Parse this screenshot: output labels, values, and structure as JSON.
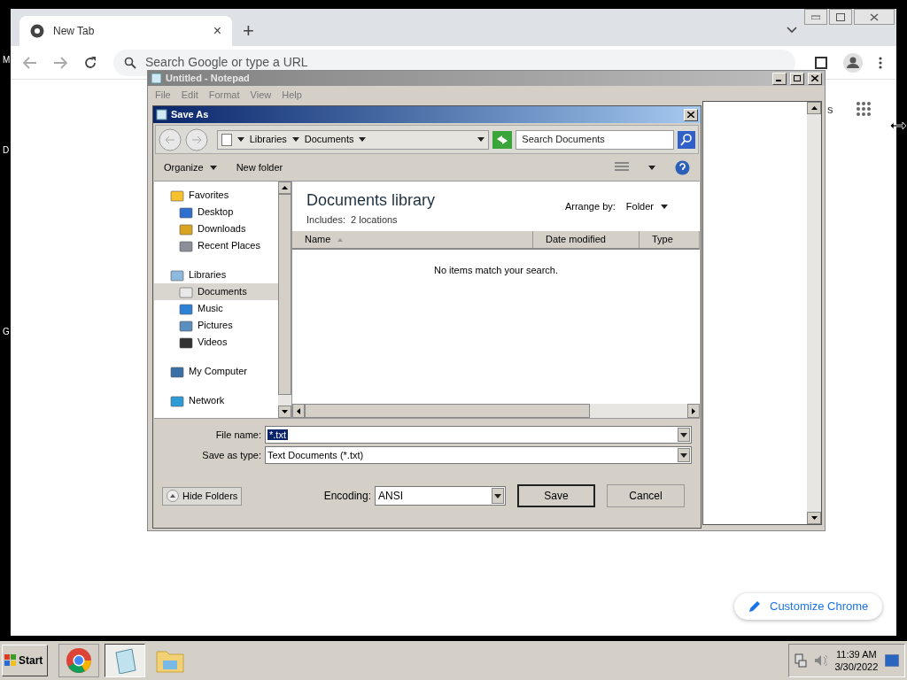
{
  "desktop": {
    "edge_letters": [
      "M",
      "D",
      "G"
    ]
  },
  "browser": {
    "tab": {
      "title": "New Tab",
      "close": "×"
    },
    "new_tab": "+",
    "search": {
      "placeholder": "Search Google or type a URL"
    },
    "partial_link": "s",
    "customize": "Customize Chrome"
  },
  "notepad": {
    "title": "Untitled - Notepad",
    "menu": [
      "File",
      "Edit",
      "Format",
      "View",
      "Help"
    ]
  },
  "dialog": {
    "title": "Save As",
    "breadcrumb": [
      "Libraries",
      "Documents"
    ],
    "search": {
      "placeholder": "Search Documents"
    },
    "toolbar": [
      {
        "label": "Organize",
        "dropdown": true
      },
      {
        "label": "New folder",
        "dropdown": false
      }
    ],
    "nav": [
      {
        "label": "Favorites",
        "selected": false,
        "children": [
          {
            "label": "Desktop",
            "selected": false
          },
          {
            "label": "Downloads",
            "selected": false
          },
          {
            "label": "Recent Places",
            "selected": false
          }
        ]
      },
      {
        "label": "Libraries",
        "selected": false,
        "children": [
          {
            "label": "Documents",
            "selected": true
          },
          {
            "label": "Music",
            "selected": false
          },
          {
            "label": "Pictures",
            "selected": false
          },
          {
            "label": "Videos",
            "selected": false
          }
        ]
      },
      {
        "label": "My Computer",
        "selected": false
      },
      {
        "label": "Network",
        "selected": false
      }
    ],
    "library": {
      "title": "Documents library",
      "includes_label": "Includes:",
      "includes_value": "2 locations",
      "arrange_label": "Arrange by:",
      "arrange_value": "Folder"
    },
    "columns": [
      {
        "label": "Name",
        "sorted": true
      },
      {
        "label": "Date modified",
        "sorted": false
      },
      {
        "label": "Type",
        "sorted": false
      }
    ],
    "empty_message": "No items match your search.",
    "file_name": {
      "label": "File name:",
      "value": "*.txt"
    },
    "save_type": {
      "label": "Save as type:",
      "value": "Text Documents (*.txt)"
    },
    "hide_folders": "Hide Folders",
    "encoding": {
      "label": "Encoding:",
      "value": "ANSI"
    },
    "buttons": [
      {
        "label": "Save",
        "default": true
      },
      {
        "label": "Cancel",
        "default": false
      }
    ]
  },
  "taskbar": {
    "start": "Start",
    "time": "11:39 AM",
    "date": "3/30/2022"
  }
}
